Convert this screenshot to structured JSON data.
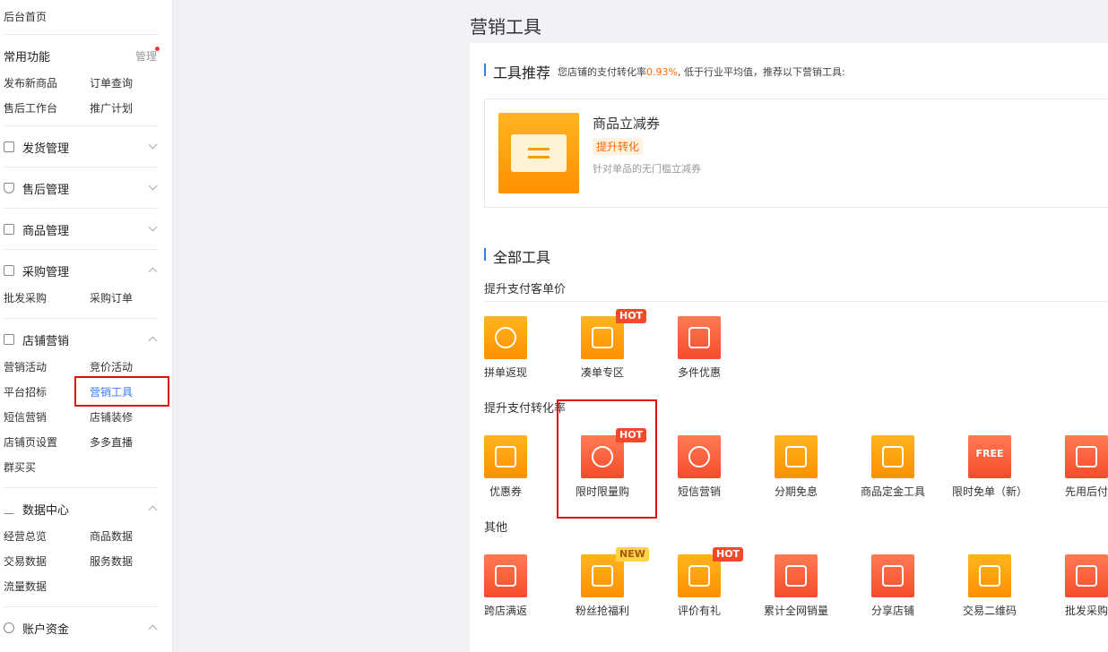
{
  "sidebar": {
    "home": "后台首页",
    "common": {
      "title": "常用功能",
      "manage": "管理",
      "links": [
        "发布新商品",
        "订单查询",
        "售后工作台",
        "推广计划"
      ]
    },
    "sections": [
      {
        "title": "发货管理",
        "icon": "document-icon"
      },
      {
        "title": "售后管理",
        "icon": "shield-icon"
      },
      {
        "title": "商品管理",
        "icon": "bag-icon"
      },
      {
        "title": "采购管理",
        "icon": "purchase-icon",
        "links": [
          "批发采购",
          "采购订单"
        ]
      },
      {
        "title": "店铺营销",
        "icon": "store-icon",
        "links": [
          "营销活动",
          "竞价活动",
          "平台招标",
          "营销工具",
          "短信营销",
          "店铺装修",
          "店铺页设置",
          "多多直播",
          "群买买"
        ]
      },
      {
        "title": "数据中心",
        "icon": "chart-icon",
        "links": [
          "经营总览",
          "商品数据",
          "交易数据",
          "服务数据",
          "流量数据"
        ]
      },
      {
        "title": "账户资金",
        "icon": "yen-circle-icon"
      }
    ]
  },
  "page": {
    "title": "营销工具"
  },
  "recommend": {
    "title": "工具推荐",
    "desc_prefix": "您店铺的支付转化率",
    "rate": "0.93%",
    "desc_suffix": ", 低于行业平均值，推荐以下营销工具:",
    "card": {
      "name": "商品立减券",
      "tag": "提升转化",
      "sub": "针对单品的无门槛立减券",
      "icon": "coupon-icon"
    }
  },
  "all_tools": {
    "title": "全部工具",
    "groups": [
      {
        "title": "提升支付客单价",
        "tools": [
          {
            "label": "拼单返现",
            "icon": "yen-coin-icon",
            "badge": ""
          },
          {
            "label": "凑单专区",
            "icon": "percent-house-icon",
            "badge": "HOT"
          },
          {
            "label": "多件优惠",
            "icon": "percent-bag-icon",
            "badge": ""
          }
        ]
      },
      {
        "title": "提升支付转化率",
        "tools": [
          {
            "label": "优惠券",
            "icon": "yen-ticket-icon",
            "badge": ""
          },
          {
            "label": "限时限量购",
            "icon": "alarm-clock-icon",
            "badge": "HOT"
          },
          {
            "label": "短信营销",
            "icon": "chat-bubble-icon",
            "badge": ""
          },
          {
            "label": "分期免息",
            "icon": "card-icon",
            "badge": ""
          },
          {
            "label": "商品定金工具",
            "icon": "yen-bag-icon",
            "badge": ""
          },
          {
            "label": "限时免单（新）",
            "icon": "free-clock-icon",
            "badge": "",
            "glyph": "FREE"
          },
          {
            "label": "先用后付",
            "icon": "badge-user-icon",
            "badge": ""
          }
        ]
      },
      {
        "title": "其他",
        "tools": [
          {
            "label": "跨店满返",
            "icon": "store-return-icon",
            "badge": ""
          },
          {
            "label": "粉丝抢福利",
            "icon": "yen-gift-icon",
            "badge": "NEW"
          },
          {
            "label": "评价有礼",
            "icon": "comment-icon",
            "badge": "HOT"
          },
          {
            "label": "累计全网销量",
            "icon": "trend-chart-icon",
            "badge": ""
          },
          {
            "label": "分享店铺",
            "icon": "share-store-icon",
            "badge": ""
          },
          {
            "label": "交易二维码",
            "icon": "qrcode-icon",
            "badge": ""
          },
          {
            "label": "批发采购",
            "icon": "cart-icon",
            "badge": ""
          }
        ]
      }
    ]
  },
  "colors": {
    "accent": "#3a7bf0",
    "orange": "#ff9000",
    "red": "#f44c2c",
    "highlight_box": "#e01010"
  }
}
